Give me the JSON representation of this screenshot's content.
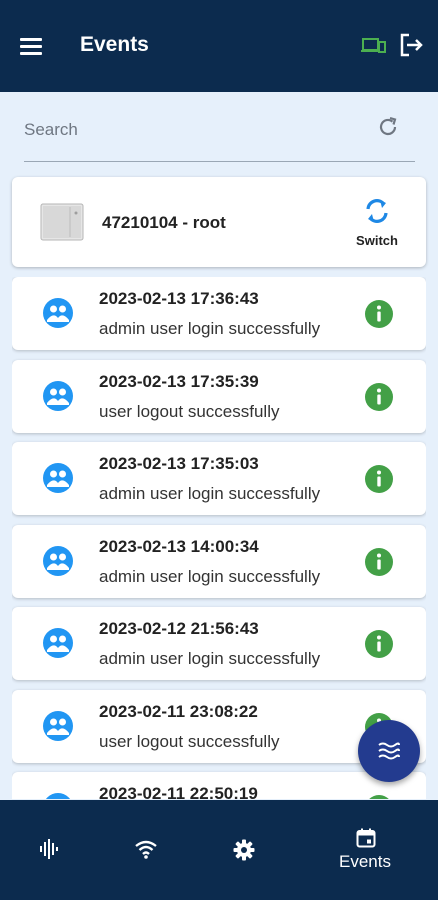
{
  "appbar": {
    "title": "Events",
    "menu_icon": "menu-icon",
    "device_icon": "devices-icon",
    "logout_icon": "logout-icon",
    "device_icon_color": "#4caf50"
  },
  "search": {
    "placeholder": "Search",
    "value": ""
  },
  "device": {
    "name": "47210104 - root",
    "switch_label": "Switch"
  },
  "events": [
    {
      "time": "2023-02-13 17:36:43",
      "message": "admin user login successfully"
    },
    {
      "time": "2023-02-13 17:35:39",
      "message": "user logout successfully"
    },
    {
      "time": "2023-02-13 17:35:03",
      "message": "admin user login successfully"
    },
    {
      "time": "2023-02-13 14:00:34",
      "message": "admin user login successfully"
    },
    {
      "time": "2023-02-12 21:56:43",
      "message": "admin user login successfully"
    },
    {
      "time": "2023-02-11 23:08:22",
      "message": "user logout successfully"
    },
    {
      "time": "2023-02-11 22:50:19",
      "message": ""
    }
  ],
  "colors": {
    "header": "#0c2b4e",
    "background": "#e6f0fb",
    "user_icon": "#2196f3",
    "info_icon": "#43a047",
    "fab": "#233b8f"
  },
  "bottom_nav": {
    "items": [
      {
        "icon": "waveform-icon",
        "label": ""
      },
      {
        "icon": "wifi-icon",
        "label": ""
      },
      {
        "icon": "gear-icon",
        "label": ""
      },
      {
        "icon": "calendar-icon",
        "label": "Events"
      }
    ]
  }
}
